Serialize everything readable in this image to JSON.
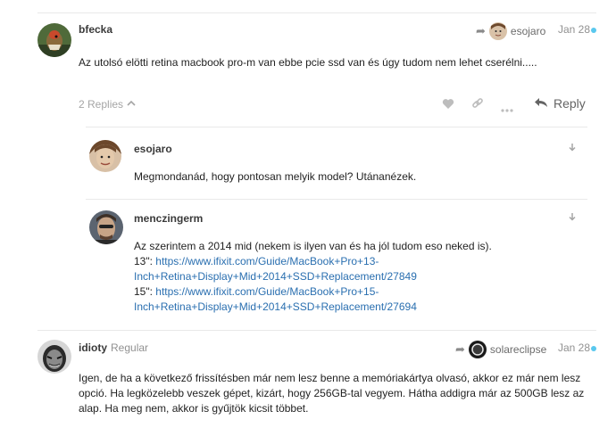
{
  "post1": {
    "username": "bfecka",
    "reply_to_username": "esojaro",
    "date": "Jan 28",
    "body": "Az utolsó elötti retina macbook pro-m van ebbe pcie ssd van és úgy tudom nem lehet cserélni.....",
    "replies_label": "2 Replies",
    "reply_label": "Reply"
  },
  "reply1": {
    "username": "esojaro",
    "body": "Megmondanád, hogy pontosan melyik model? Utánanézek."
  },
  "reply2": {
    "username": "menczingerm",
    "line1": "Az szerintem a 2014 mid (nekem is ilyen van és ha jól tudom eso neked is).",
    "link13_prefix": "13\": ",
    "link13_a": "https://www.ifixit.com/Guide/MacBook+Pro+13-",
    "link13_b": "Inch+Retina+Display+Mid+2014+SSD+Replacement/27849",
    "link15_prefix": "15\": ",
    "link15_a": "https://www.ifixit.com/Guide/MacBook+Pro+15-",
    "link15_b": "Inch+Retina+Display+Mid+2014+SSD+Replacement/27694"
  },
  "post2": {
    "username": "idioty",
    "user_title": "Regular",
    "reply_to_username": "solareclipse",
    "date": "Jan 28",
    "body_lines": [
      "Igen, de ha a következő frissítésben már nem lesz benne a memóriakártya olvasó, akkor ez már nem lesz",
      "opció. Ha legközelebb veszek gépet, kizárt, hogy 256GB-tal vegyem. Hátha addigra már az 500GB lesz az",
      "alap. Ha meg nem, akkor is gyűjtök kicsit többet."
    ]
  },
  "colors": {
    "link": "#2a6fb0",
    "unread_dot": "#5ac8ee",
    "muted": "#919191"
  }
}
